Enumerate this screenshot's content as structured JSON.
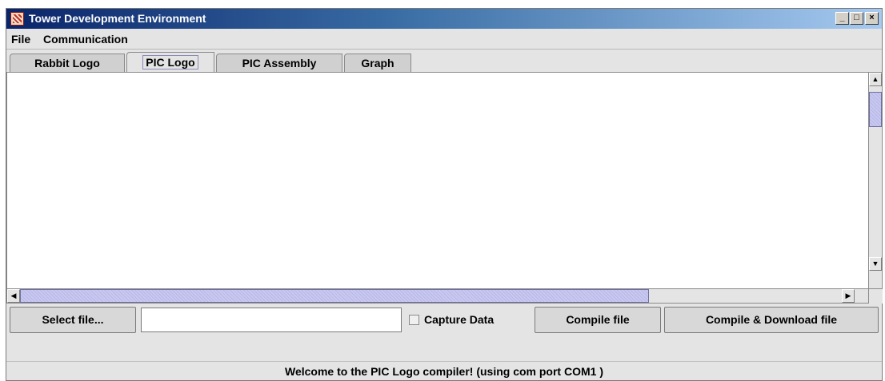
{
  "window": {
    "title": "Tower Development Environment",
    "minimize_glyph": "_",
    "maximize_glyph": "□",
    "close_glyph": "×"
  },
  "menu": {
    "items": [
      {
        "label": "File"
      },
      {
        "label": "Communication"
      }
    ]
  },
  "tabs": [
    {
      "label": "Rabbit Logo",
      "active": false
    },
    {
      "label": "PIC Logo",
      "active": true
    },
    {
      "label": "PIC Assembly",
      "active": false
    },
    {
      "label": "Graph",
      "active": false
    }
  ],
  "editor": {
    "content": ""
  },
  "scroll": {
    "up_glyph": "▲",
    "down_glyph": "▼",
    "left_glyph": "◀",
    "right_glyph": "▶"
  },
  "controls": {
    "select_file_label": "Select file...",
    "file_path_value": "",
    "capture_data_label": "Capture Data",
    "capture_data_checked": false,
    "compile_label": "Compile file",
    "compile_download_label": "Compile & Download file"
  },
  "status": {
    "message": "Welcome to the PIC Logo compiler! (using com port COM1 )"
  },
  "colors": {
    "titlebar_start": "#0a246a",
    "titlebar_end": "#a6caf0",
    "window_bg": "#e4e4e4",
    "scroll_thumb": "#c8c8f0"
  }
}
